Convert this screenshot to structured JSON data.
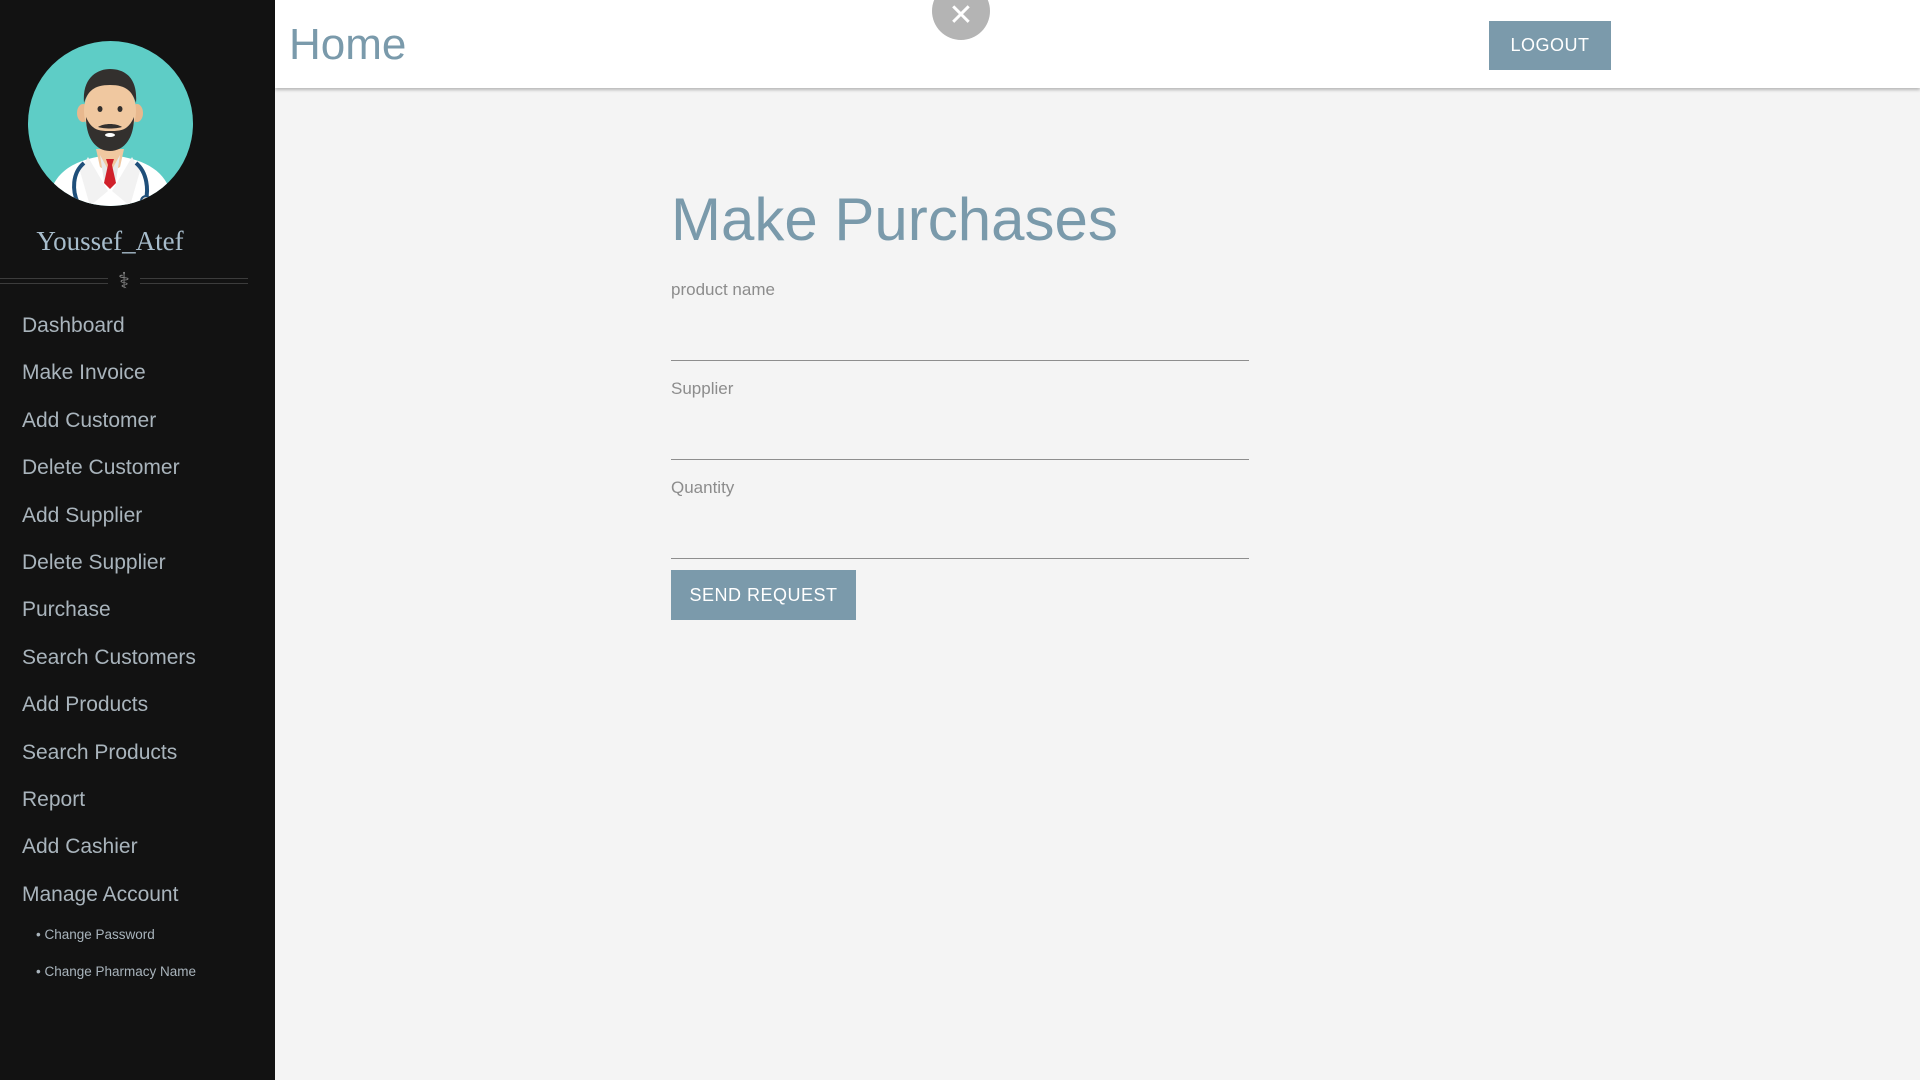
{
  "sidebar": {
    "username": "Youssef_Atef",
    "divider_symbol": "⚕",
    "items": [
      {
        "label": "Dashboard"
      },
      {
        "label": "Make Invoice"
      },
      {
        "label": "Add Customer"
      },
      {
        "label": "Delete Customer"
      },
      {
        "label": "Add Supplier"
      },
      {
        "label": "Delete Supplier"
      },
      {
        "label": "Purchase"
      },
      {
        "label": "Search Customers"
      },
      {
        "label": "Add Products"
      },
      {
        "label": "Search Products"
      },
      {
        "label": "Report"
      },
      {
        "label": "Add Cashier"
      },
      {
        "label": "Manage Account"
      }
    ],
    "subitems": [
      {
        "label": "• Change Password"
      },
      {
        "label": "• Change Pharmacy Name"
      }
    ]
  },
  "header": {
    "title": "Home",
    "close_glyph": "✕",
    "logout_label": "LOGOUT"
  },
  "form": {
    "title": "Make Purchases",
    "fields": [
      {
        "label": "product name",
        "value": ""
      },
      {
        "label": "Supplier",
        "value": ""
      },
      {
        "label": "Quantity",
        "value": ""
      }
    ],
    "submit_label": "SEND REQUEST"
  },
  "colors": {
    "sidebar_bg": "#121212",
    "accent": "#7b9aab",
    "page_bg": "#f4f4f4",
    "avatar_bg": "#5ecdc6"
  },
  "icons": {
    "avatar": "doctor-avatar-icon",
    "divider": "caduceus-icon",
    "close": "close-icon"
  }
}
